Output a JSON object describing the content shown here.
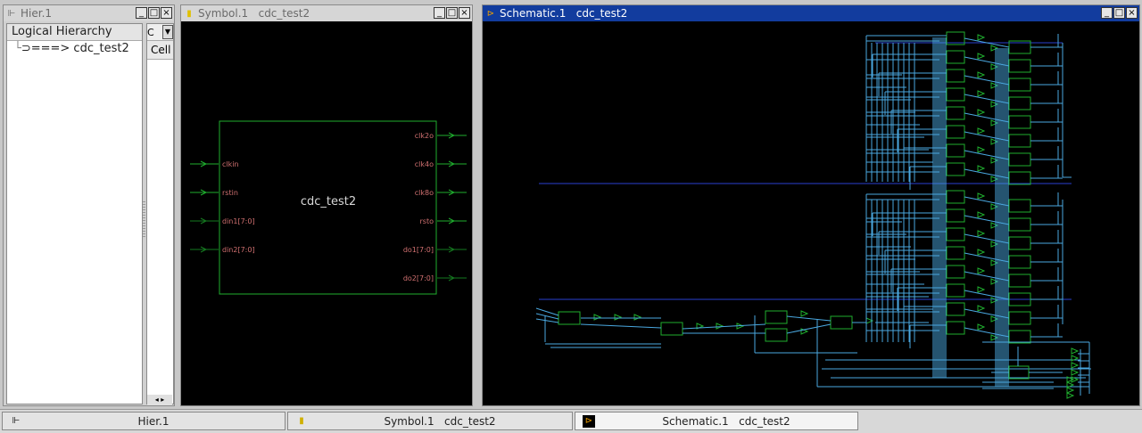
{
  "hier_window": {
    "title": "Hier.1",
    "header": "Logical Hierarchy",
    "tree_item": "===> cdc_test2",
    "combo_value": "C",
    "cell_header": "Cell",
    "min_btn": "_",
    "max_btn": "□",
    "close_btn": "×",
    "scroll_left": "◂",
    "scroll_right": "▸"
  },
  "symbol_window": {
    "title": "Symbol.1   cdc_test2",
    "symbol_name": "cdc_test2",
    "input_ports": [
      "clkin",
      "rstin",
      "din1[7:0]",
      "din2[7:0]"
    ],
    "output_ports": [
      "clk2o",
      "clk4o",
      "clk8o",
      "rsto",
      "do1[7:0]",
      "do2[7:0]"
    ],
    "colors": {
      "box": "#1fae2e",
      "port_text": "#d07070",
      "name_text": "#d8d8d8"
    }
  },
  "schematic_window": {
    "title": "Schematic.1   cdc_test2",
    "colors": {
      "wire": "#4aa8e0",
      "bus": "#2a3fd0",
      "cell": "#1fae2e"
    }
  },
  "taskbar": {
    "items": [
      {
        "label": "Hier.1",
        "icon": "hierarchy-icon"
      },
      {
        "label": "Symbol.1   cdc_test2",
        "icon": "symbol-icon"
      },
      {
        "label": "Schematic.1   cdc_test2",
        "icon": "schematic-icon"
      }
    ]
  }
}
